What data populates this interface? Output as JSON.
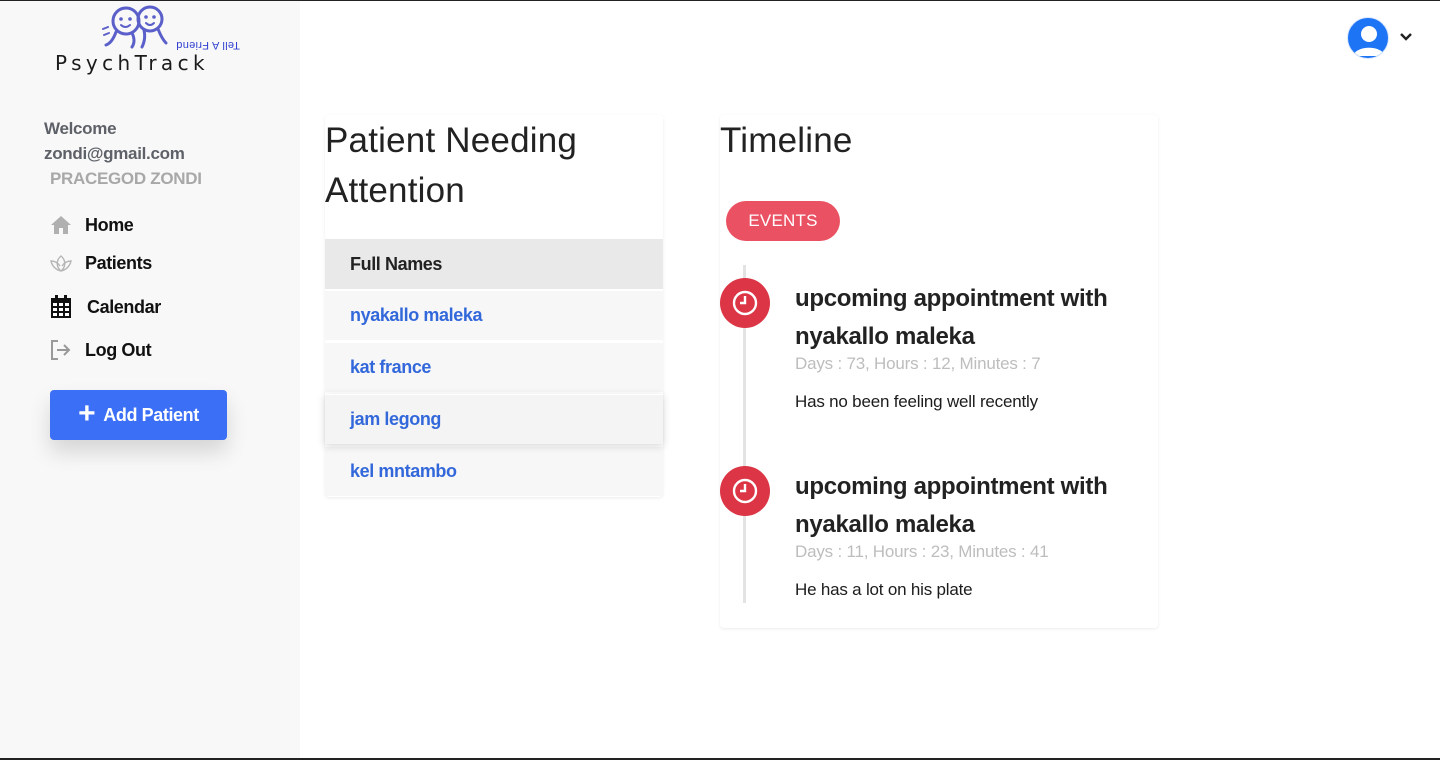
{
  "brand": {
    "name": "PsychTrack",
    "tagline": "Tell A Friend",
    "colors": {
      "accent": "#3b6ff5",
      "logo": "#5a5fc9",
      "danger": "#dc3545",
      "badge": "#ea5264",
      "link": "#3368db"
    }
  },
  "sidebar": {
    "welcome_label": "Welcome",
    "email": "zondi@gmail.com",
    "user_name": "PRACEGOD ZONDI",
    "nav": [
      {
        "label": "Home",
        "icon": "home-icon"
      },
      {
        "label": "Patients",
        "icon": "lotus-icon"
      },
      {
        "label": "Calendar",
        "icon": "calendar-icon"
      },
      {
        "label": "Log Out",
        "icon": "logout-icon"
      }
    ],
    "add_patient_label": "Add Patient"
  },
  "header": {
    "avatar_icon": "user-avatar-icon",
    "menu_icon": "chevron-down-icon"
  },
  "patients_card": {
    "title": "Patient Needing Attention",
    "column_header": "Full Names",
    "rows": [
      "nyakallo maleka",
      "kat france",
      "jam legong",
      "kel mntambo"
    ]
  },
  "timeline": {
    "title": "Timeline",
    "badge": "EVENTS",
    "items": [
      {
        "title": "upcoming appointment with nyakallo maleka",
        "time_left": "Days : 73, Hours : 12, Minutes : 7",
        "description": "Has no been feeling well recently"
      },
      {
        "title": "upcoming appointment with nyakallo maleka",
        "time_left": "Days : 11, Hours : 23, Minutes : 41",
        "description": "He has a lot on his plate"
      }
    ]
  }
}
